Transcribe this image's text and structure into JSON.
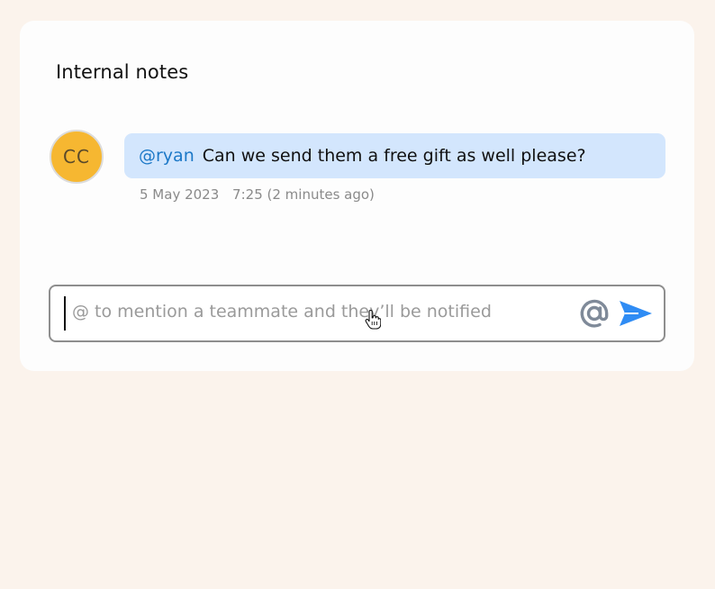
{
  "panel": {
    "title": "Internal notes"
  },
  "note": {
    "avatar_initials": "CC",
    "mention": "@ryan",
    "text": "Can we send them a free gift as well please?",
    "date": "5 May 2023",
    "time": "7:25 (2 minutes ago)"
  },
  "composer": {
    "placeholder": "@ to mention a teammate and they’ll be notified",
    "mention_icon": "at-sign-icon",
    "send_icon": "send-icon"
  },
  "colors": {
    "background": "#fbf3ec",
    "avatar": "#f6b731",
    "bubble": "#d3e6fd",
    "mention": "#1c78c7",
    "send": "#2f8cf4",
    "at_icon": "#7f8a99"
  }
}
